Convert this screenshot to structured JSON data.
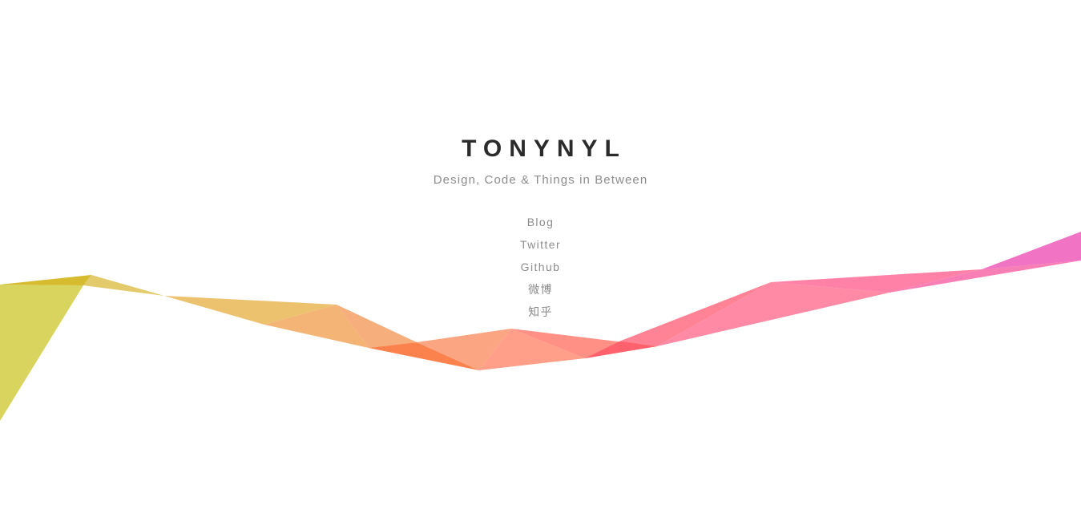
{
  "header": {
    "title": "TONYNYL",
    "tagline": "Design, Code & Things in Between"
  },
  "nav": {
    "items": [
      {
        "label": "Blog",
        "name": "nav-link-blog"
      },
      {
        "label": "Twitter",
        "name": "nav-link-twitter"
      },
      {
        "label": "Github",
        "name": "nav-link-github"
      },
      {
        "label": "微博",
        "name": "nav-link-weibo"
      },
      {
        "label": "知乎",
        "name": "nav-link-zhihu"
      }
    ]
  },
  "colors": {
    "title": "#2b2b2b",
    "text_muted": "#8c8c8c",
    "background": "#ffffff",
    "ribbon_yellow": "#d6d04f",
    "ribbon_orange": "#f7a766",
    "ribbon_coral": "#ff8a7a",
    "ribbon_pink": "#ff7aa2",
    "ribbon_magenta": "#f06cc0"
  }
}
